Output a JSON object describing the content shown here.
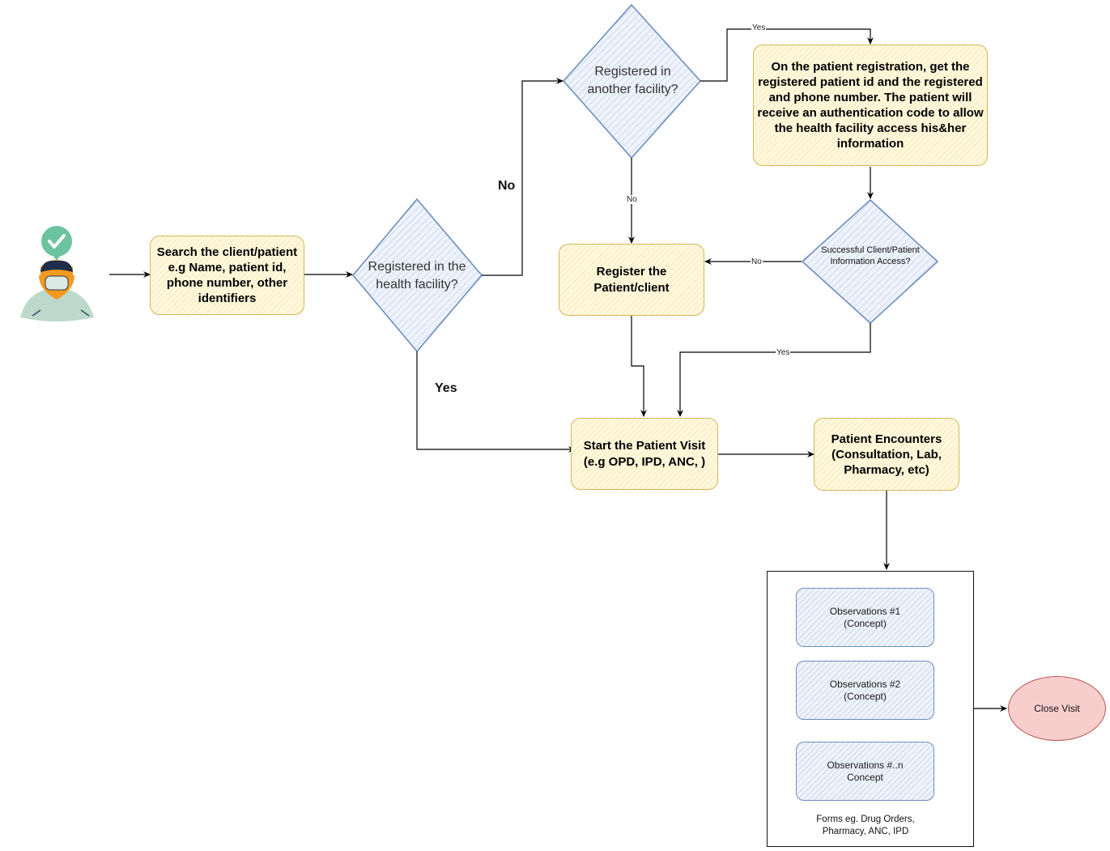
{
  "diagram": {
    "actor": {
      "icon": "health-worker-with-mask-icon",
      "badge_icon": "checkmark-icon",
      "badge_color": "#6cc3a0"
    },
    "nodes": {
      "search": "Search the client/patient e.g Name, patient id, phone number, other identifiers",
      "registered_here": "Registered in the health facility?",
      "registered_other": "Registered in another facility?",
      "get_registration": "On the patient registration, get the registered patient id and the registered and phone number. The patient will receive an authentication code to allow the health facility access his&her information",
      "access_success": "Successful Client/Patient Information Access?",
      "register_patient": "Register the Patient/client",
      "start_visit": "Start the Patient Visit (e.g OPD, IPD, ANC, )",
      "encounters": "Patient Encounters (Consultation, Lab, Pharmacy, etc)",
      "obs1": "Observations #1 (Concept)",
      "obs2": "Observations #2 (Concept)",
      "obsn": "Observations #..n Concept",
      "forms": "Forms eg. Drug Orders, Pharmacy, ANC, IPD",
      "close_visit": "Close Visit"
    },
    "edge_labels": {
      "no_main": "No",
      "yes_main": "Yes",
      "yes_other": "Yes",
      "no_other": "No",
      "no_access": "No",
      "yes_access": "Yes"
    },
    "colors": {
      "process_fill": "#fff8dc",
      "process_stroke": "#d6b656",
      "decision_fill": "#eef3fb",
      "decision_stroke": "#6c8ebf",
      "terminal_fill": "#f8cecc",
      "terminal_stroke": "#b85450"
    }
  }
}
